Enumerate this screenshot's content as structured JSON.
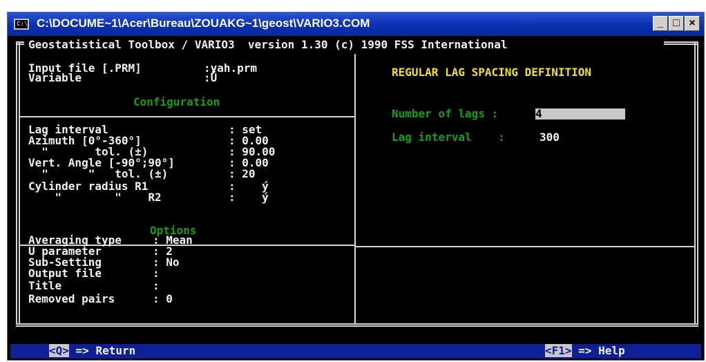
{
  "window": {
    "title": "C:\\DOCUME~1\\Acer\\Bureau\\ZOUAKG~1\\geost\\VARIO3.COM",
    "app_icon": "C:\\",
    "minimize_label": "_",
    "maximize_label": "□",
    "close_label": "×"
  },
  "header": "Geostatistical Toolbox / VARIO3  version 1.30 (c) 1990 FSS International",
  "input": {
    "file_label": "Input file [.PRM]",
    "file_value": ":yah.prm",
    "variable_label": "Variable",
    "variable_value": ":Ü"
  },
  "configuration": {
    "title": "Configuration",
    "rows": [
      {
        "label": "Lag interval",
        "value": ": set"
      },
      {
        "label": "Azimuth [0°-360°]",
        "value": ": 0.00"
      },
      {
        "label": "  \"       tol. (±)",
        "value": ": 90.00"
      },
      {
        "label": "Vert. Angle [-90°;90°]",
        "value": ": 0.00"
      },
      {
        "label": "  \"      \"   tol. (±)",
        "value": ": 20"
      },
      {
        "label": "Cylinder radius R1",
        "value": ":    ý"
      },
      {
        "label": "    \"        \"    R2",
        "value": ":    ý"
      }
    ]
  },
  "options": {
    "title": "Options",
    "rows": [
      {
        "label": "Averaging type",
        "value": ": Mean"
      },
      {
        "label": "Ü parameter",
        "value": ": 2"
      },
      {
        "label": "Sub-Setting",
        "value": ": No"
      },
      {
        "label": "Output file",
        "value": ":"
      },
      {
        "label": "Title",
        "value": ":"
      },
      {
        "label": "Removed pairs",
        "value": ": 0"
      }
    ]
  },
  "right_panel": {
    "title": "REGULAR LAG SPACING DEFINITION",
    "number_of_lags_label": "Number of lags :",
    "number_of_lags_value": "4",
    "lag_interval_label": "Lag interval    :",
    "lag_interval_value": "300"
  },
  "footer": {
    "return_key": "<Q>",
    "return_label": " => Return",
    "help_key": "<F1>",
    "help_label": " => Help"
  },
  "colors": {
    "title_bar": "#0a2fb0",
    "console_bg": "#000000",
    "text_white": "#f2f2f2",
    "text_green": "#14a014",
    "text_yellow": "#f5e21a",
    "status_bar": "#0f1f95"
  }
}
